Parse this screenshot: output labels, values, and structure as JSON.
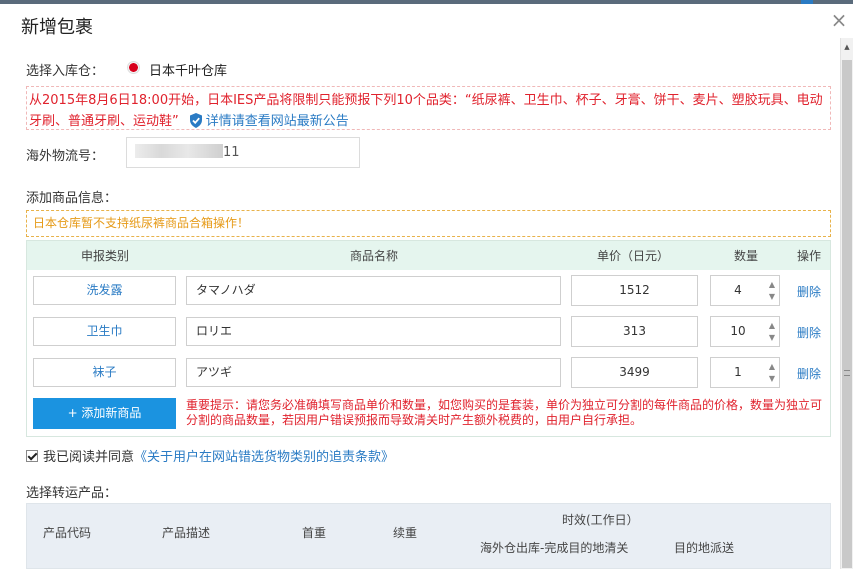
{
  "dialog": {
    "title": "新增包裹",
    "close_glyph": "×"
  },
  "warehouse": {
    "label": "选择入库仓：",
    "name": "日本千叶仓库"
  },
  "notice": {
    "text": "从2015年8月6日18:00开始，日本IES产品将限制只能预报下列10个品类：“纸尿裤、卫生巾、杯子、牙膏、饼干、麦片、塑胶玩具、电动牙刷、普通牙刷、运动鞋”",
    "link": "详情请查看网站最新公告"
  },
  "tracking": {
    "label": "海外物流号：",
    "value_suffix": "11"
  },
  "goods": {
    "label": "添加商品信息：",
    "warning": "日本仓库暂不支持纸尿裤商品合箱操作！",
    "headers": {
      "category": "申报类别",
      "name": "商品名称",
      "price": "单价（日元）",
      "qty": "数量",
      "action": "操作"
    },
    "rows": [
      {
        "category": "洗发露",
        "name": "タマノハダ",
        "price": "1512",
        "qty": "4",
        "action": "删除"
      },
      {
        "category": "卫生巾",
        "name": "ロリエ",
        "price": "313",
        "qty": "10",
        "action": "删除"
      },
      {
        "category": "袜子",
        "name": "アツギ",
        "price": "3499",
        "qty": "1",
        "action": "删除"
      }
    ],
    "add_button": "+ 添加新商品",
    "tip": "重要提示：请您务必准确填写商品单价和数量，如您购买的是套装，单价为独立可分割的每件商品的价格，数量为独立可分割的商品数量，若因用户错误预报而导致清关时产生额外税费的，由用户自行承担。"
  },
  "agreement": {
    "text": "我已阅读并同意",
    "link": "《关于用户在网站错选货物类别的追责条款》"
  },
  "shipping": {
    "label": "选择转运产品：",
    "headers": {
      "code": "产品代码",
      "desc": "产品描述",
      "first_weight": "首重",
      "extra_weight": "续重",
      "timing": "时效(工作日）",
      "timing_sub1": "海外仓出库-完成目的地清关",
      "timing_sub2": "目的地派送"
    }
  },
  "colors": {
    "accent": "#1b93e0",
    "link": "#2a7bc4",
    "alert": "#e0222d",
    "warning": "#e69a17",
    "table_header": "#e5f5ee"
  }
}
